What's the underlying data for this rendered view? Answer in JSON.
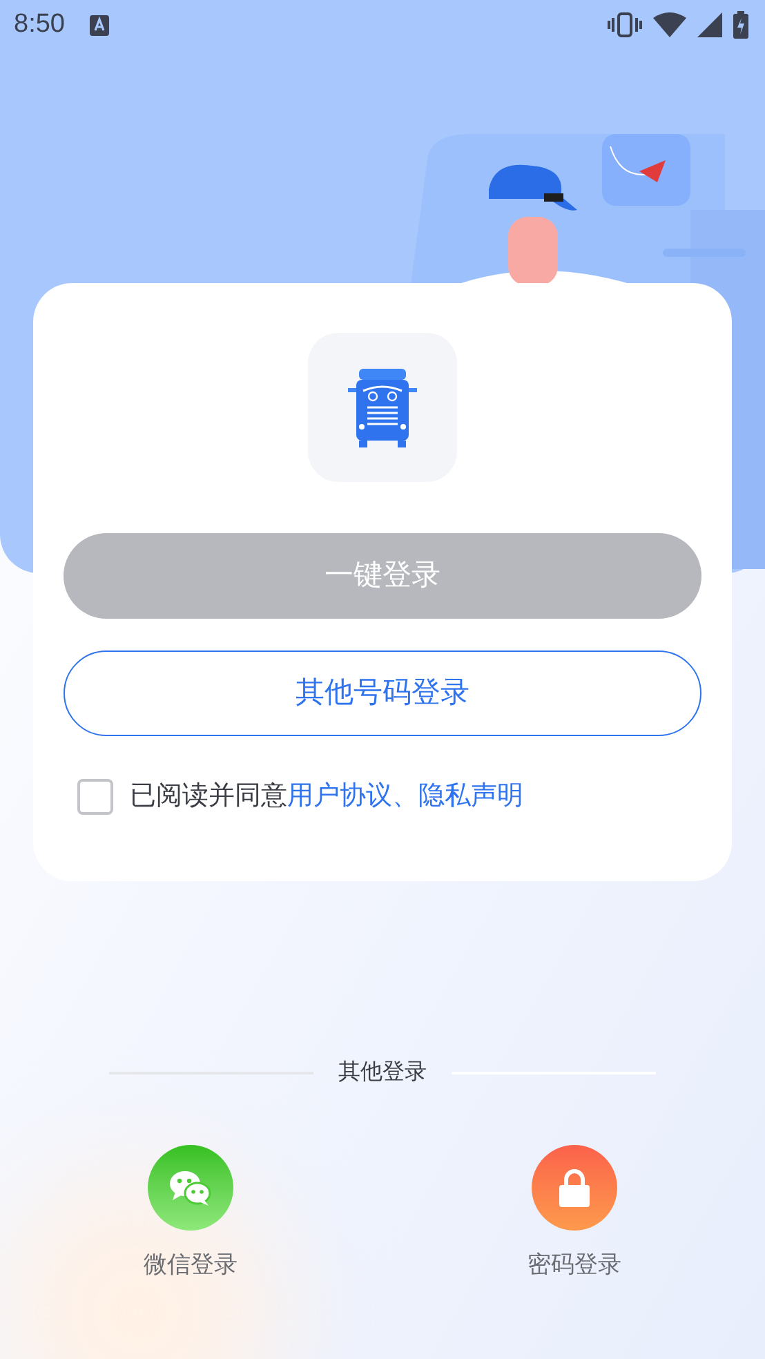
{
  "status_bar": {
    "time": "8:50"
  },
  "login_card": {
    "one_tap_button": {
      "label": "一键登录",
      "disabled": true
    },
    "other_number_button": {
      "label": "其他号码登录"
    },
    "agreement": {
      "checked": false,
      "text": "已阅读并同意",
      "link": "用户协议、隐私声明"
    }
  },
  "other_login": {
    "title": "其他登录",
    "options": [
      {
        "kind": "wechat",
        "label": "微信登录"
      },
      {
        "kind": "password",
        "label": "密码登录"
      }
    ]
  }
}
